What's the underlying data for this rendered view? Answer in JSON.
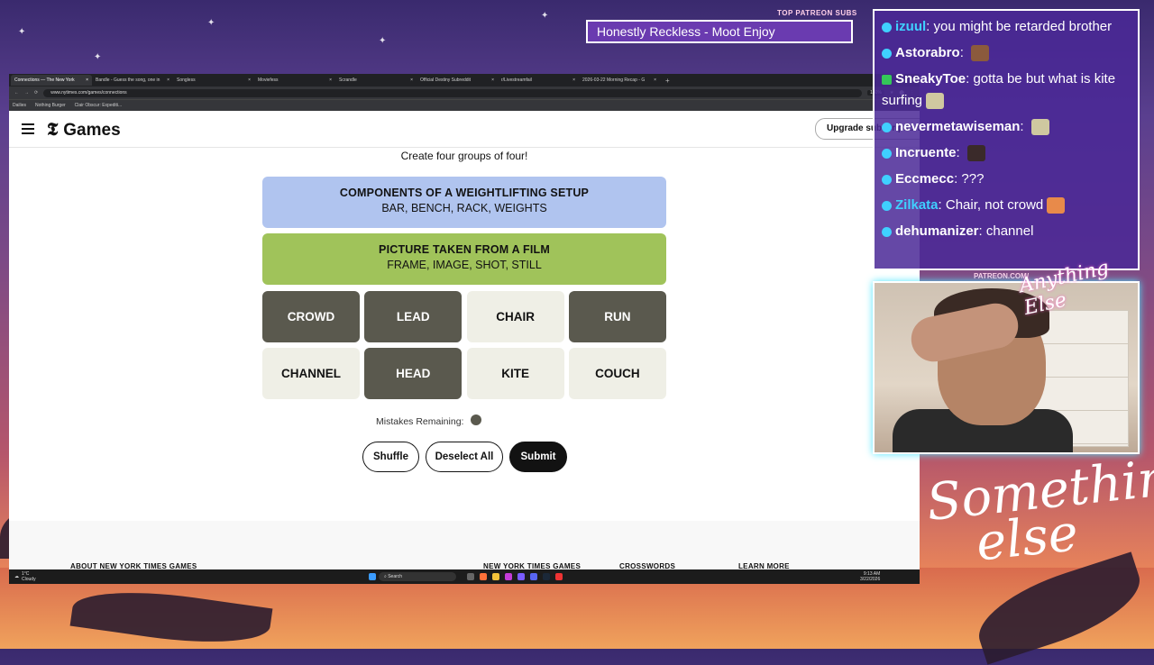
{
  "overlay": {
    "top_sub_label": "TOP PATREON SUBS",
    "ticker_text": "Honestly Reckless - Moot Enjoy",
    "patreon_label": "PATREON.COM/",
    "cam_script": "Anything Else",
    "brand_script_line1": "Something",
    "brand_script_line2": "else"
  },
  "browser": {
    "tabs": [
      {
        "label": "Connections — The New York",
        "active": true
      },
      {
        "label": "Bandle - Guess the song, one in",
        "active": false
      },
      {
        "label": "Songless",
        "active": false
      },
      {
        "label": "Moviefess",
        "active": false
      },
      {
        "label": "Scrandle",
        "active": false
      },
      {
        "label": "Official Destiny Subreddit",
        "active": false
      },
      {
        "label": "r/Livestreamfail",
        "active": false
      },
      {
        "label": "2026-03-22 Morning Recap - G",
        "active": false
      }
    ],
    "url": "www.nytimes.com/games/connections",
    "zoom": "160%",
    "bookmarks": [
      "Dailies",
      "Nothing Burger",
      "Clair Obscur: Expediti..."
    ]
  },
  "site": {
    "logo_letter": "𝕿",
    "games_label": "Games",
    "upgrade_label": "Upgrade subscription",
    "subtitle": "Create four groups of four!"
  },
  "groups": [
    {
      "title": "COMPONENTS OF A WEIGHTLIFTING SETUP",
      "words": "BAR, BENCH, RACK, WEIGHTS",
      "color": "#b0c4ef"
    },
    {
      "title": "PICTURE TAKEN FROM A FILM",
      "words": "FRAME, IMAGE, SHOT, STILL",
      "color": "#a0c35a"
    }
  ],
  "tiles": [
    {
      "word": "CROWD",
      "selected": true
    },
    {
      "word": "LEAD",
      "selected": true
    },
    {
      "word": "CHAIR",
      "selected": false
    },
    {
      "word": "RUN",
      "selected": true
    },
    {
      "word": "CHANNEL",
      "selected": false
    },
    {
      "word": "HEAD",
      "selected": true
    },
    {
      "word": "KITE",
      "selected": false
    },
    {
      "word": "COUCH",
      "selected": false
    }
  ],
  "mistakes": {
    "label": "Mistakes Remaining:",
    "remaining": 1
  },
  "buttons": {
    "shuffle": "Shuffle",
    "deselect": "Deselect All",
    "submit": "Submit"
  },
  "footer": {
    "headings": [
      "ABOUT NEW YORK TIMES GAMES",
      "NEW YORK TIMES GAMES",
      "CROSSWORDS",
      "LEARN MORE"
    ]
  },
  "taskbar": {
    "weather_temp": "1°C",
    "weather_desc": "Cloudy",
    "search": "Search",
    "time": "9:13 AM",
    "date": "3/22/2026"
  },
  "chat": [
    {
      "user": "izuul",
      "text": "you might be retarded brother",
      "user_color": "#3fd0ff"
    },
    {
      "user": "Astorabro",
      "text": "",
      "user_color": "#ffffff"
    },
    {
      "user": "SneakyToe",
      "text": "gotta be but what is kite surfing",
      "user_color": "#ffffff"
    },
    {
      "user": "nevermetawiseman",
      "text": "",
      "user_color": "#ffffff"
    },
    {
      "user": "Incruente",
      "text": "",
      "user_color": "#ffffff"
    },
    {
      "user": "Eccmecc",
      "text": "???",
      "user_color": "#ffffff"
    },
    {
      "user": "Zilkata",
      "text": "Chair, not crowd",
      "user_color": "#3fd0ff"
    },
    {
      "user": "dehumanizer",
      "text": "channel",
      "user_color": "#ffffff"
    }
  ]
}
